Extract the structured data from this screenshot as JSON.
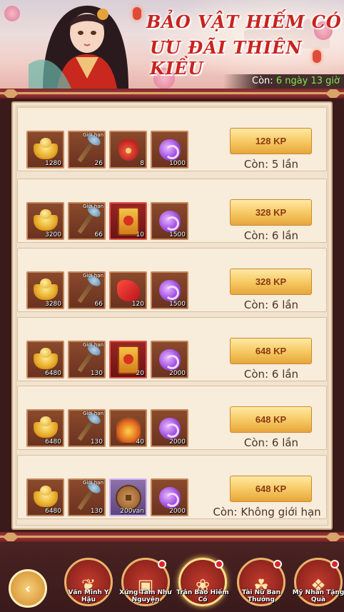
{
  "banner": {
    "title_line1": "BẢO VẬT HIẾM CÓ",
    "title_line2": "ƯU ĐÃI THIÊN KIỀU",
    "timer_label": "Còn:",
    "timer_value": "6 ngày 13 giờ"
  },
  "packs": [
    {
      "items": [
        {
          "icon": "gold-ingot",
          "count": "1280"
        },
        {
          "icon": "scepter",
          "count": "26",
          "tag": "Giới hạn"
        },
        {
          "icon": "red-pouch",
          "count": "8"
        },
        {
          "icon": "purple-gem",
          "count": "1000"
        }
      ],
      "price": "128 KP",
      "remaining": "Còn: 5 lần"
    },
    {
      "items": [
        {
          "icon": "gold-ingot",
          "count": "3200"
        },
        {
          "icon": "scepter",
          "count": "66",
          "tag": "Giới hạn"
        },
        {
          "icon": "gold-ticket",
          "count": "10"
        },
        {
          "icon": "purple-gem",
          "count": "1500"
        }
      ],
      "price": "328 KP",
      "remaining": "Còn: 6 lần"
    },
    {
      "items": [
        {
          "icon": "gold-ingot",
          "count": "3280"
        },
        {
          "icon": "scepter",
          "count": "66",
          "tag": "Giới hạn"
        },
        {
          "icon": "red-cloth",
          "count": "120"
        },
        {
          "icon": "purple-gem",
          "count": "1500"
        }
      ],
      "price": "328 KP",
      "remaining": "Còn: 6 lần"
    },
    {
      "items": [
        {
          "icon": "gold-ingot",
          "count": "6480"
        },
        {
          "icon": "scepter",
          "count": "130",
          "tag": "Giới hạn"
        },
        {
          "icon": "gold-ticket",
          "count": "20"
        },
        {
          "icon": "purple-gem",
          "count": "2000"
        }
      ],
      "price": "648 KP",
      "remaining": "Còn: 6 lần"
    },
    {
      "items": [
        {
          "icon": "gold-ingot",
          "count": "6480"
        },
        {
          "icon": "scepter",
          "count": "130",
          "tag": "Giới hạn"
        },
        {
          "icon": "flame-spear",
          "count": "40"
        },
        {
          "icon": "purple-gem",
          "count": "2000"
        }
      ],
      "price": "648 KP",
      "remaining": "Còn: 6 lần"
    },
    {
      "items": [
        {
          "icon": "gold-ingot",
          "count": "6480"
        },
        {
          "icon": "scepter",
          "count": "130",
          "tag": "Giới hạn"
        },
        {
          "icon": "bronze-coin",
          "count": "200van"
        },
        {
          "icon": "purple-gem",
          "count": "2000"
        }
      ],
      "price": "648 KP",
      "remaining": "Còn: Không giới hạn"
    }
  ],
  "nav": {
    "tabs": [
      {
        "label": "Văn Minh Y Hậu",
        "icon": "fairy-icon",
        "badge": false
      },
      {
        "label": "Xứng Tâm Như Nguyện",
        "icon": "chest-icon",
        "badge": true
      },
      {
        "label": "Trân Bảo Hiếm Có",
        "icon": "shell-icon",
        "badge": true,
        "active": true
      },
      {
        "label": "Tài Nữ Ban Thưởng",
        "icon": "hat-icon",
        "badge": true
      },
      {
        "label": "Mỹ Nhân Tặng Quà",
        "icon": "giftbox-icon",
        "badge": true
      }
    ]
  }
}
